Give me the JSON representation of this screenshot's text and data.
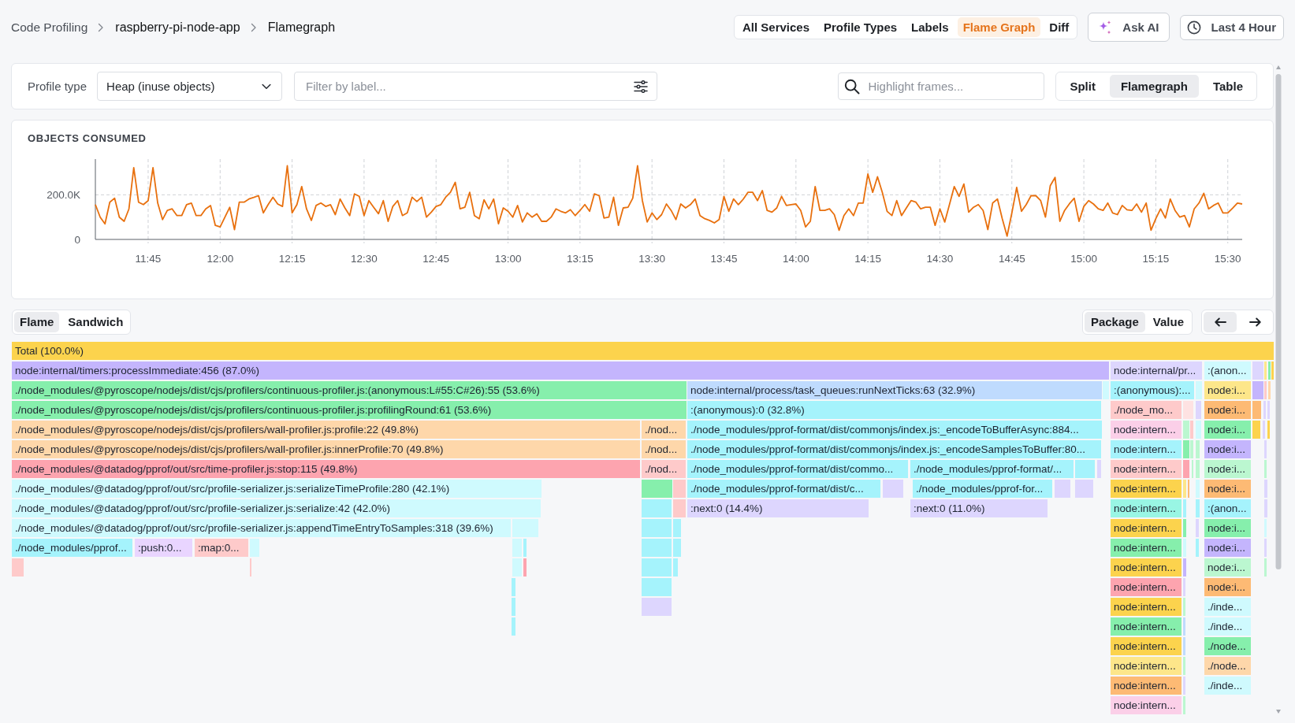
{
  "breadcrumbs": [
    "Code Profiling",
    "raspberry-pi-node-app",
    "Flamegraph"
  ],
  "nav_tabs": [
    {
      "label": "All Services",
      "selected": false
    },
    {
      "label": "Profile Types",
      "selected": false
    },
    {
      "label": "Labels",
      "selected": false
    },
    {
      "label": "Flame Graph",
      "selected": true
    },
    {
      "label": "Diff",
      "selected": false
    }
  ],
  "ask_ai_button": {
    "label": "Ask AI"
  },
  "time_range_button": {
    "label": "Last 4 Hour"
  },
  "filters": {
    "profile_type": {
      "label": "Profile type",
      "value": "Heap (inuse objects)"
    },
    "label_filter": {
      "placeholder": "Filter by label..."
    },
    "highlight": {
      "placeholder": "Highlight frames..."
    },
    "view_modes": [
      {
        "label": "Split",
        "selected": false
      },
      {
        "label": "Flamegraph",
        "selected": true
      },
      {
        "label": "Table",
        "selected": false
      }
    ]
  },
  "chart": {
    "chart_data": {
      "type": "line",
      "title": "OBJECTS CONSUMED",
      "grid": true,
      "x": [
        694,
        695,
        696,
        697,
        698,
        699,
        700,
        701,
        702,
        703,
        704,
        705,
        706,
        707,
        708,
        709,
        710,
        711,
        712,
        713,
        714,
        715,
        716,
        717,
        718,
        719,
        720,
        721,
        722,
        723,
        724,
        725,
        726,
        727,
        728,
        729,
        730,
        731,
        732,
        733,
        734,
        735,
        736,
        737,
        738,
        739,
        740,
        741,
        742,
        743,
        744,
        745,
        746,
        747,
        748,
        749,
        750,
        751,
        752,
        753,
        754,
        755,
        756,
        757,
        758,
        759,
        760,
        761,
        762,
        763,
        764,
        765,
        766,
        767,
        768,
        769,
        770,
        771,
        772,
        773,
        774,
        775,
        776,
        777,
        778,
        779,
        780,
        781,
        782,
        783,
        784,
        785,
        786,
        787,
        788,
        789,
        790,
        791,
        792,
        793,
        794,
        795,
        796,
        797,
        798,
        799,
        800,
        801,
        802,
        803,
        804,
        805,
        806,
        807,
        808,
        809,
        810,
        811,
        812,
        813,
        814,
        815,
        816,
        817,
        818,
        819,
        820,
        821,
        822,
        823,
        824,
        825,
        826,
        827,
        828,
        829,
        830,
        831,
        832,
        833,
        834,
        835,
        836,
        837,
        838,
        839,
        840,
        841,
        842,
        843,
        844,
        845,
        846,
        847,
        848,
        849,
        850,
        851,
        852,
        853,
        854,
        855,
        856,
        857,
        858,
        859,
        860,
        861,
        862,
        863,
        864,
        865,
        866,
        867,
        868,
        869,
        870,
        871,
        872,
        873,
        874,
        875,
        876,
        877,
        878,
        879,
        880,
        881,
        882,
        883,
        884,
        885,
        886,
        887,
        888,
        889,
        890,
        891,
        892,
        893,
        894,
        895,
        896,
        897,
        898,
        899,
        900,
        901,
        902,
        903,
        904,
        905,
        906,
        907,
        908,
        909,
        910,
        911,
        912,
        913,
        914,
        915,
        916,
        917,
        918,
        919,
        920,
        921,
        922,
        923,
        924,
        925,
        926,
        927,
        928,
        929,
        930,
        931,
        932,
        933
      ],
      "series": [
        {
          "color": "#e8700e",
          "values": [
            156000,
            100000,
            70000,
            167000,
            185000,
            100000,
            81000,
            137000,
            322000,
            167000,
            156000,
            174000,
            322000,
            163000,
            89000,
            130000,
            137000,
            107000,
            107000,
            156000,
            163000,
            107000,
            107000,
            137000,
            152000,
            63000,
            56000,
            100000,
            144000,
            44000,
            167000,
            167000,
            181000,
            188000,
            196000,
            119000,
            156000,
            189000,
            159000,
            148000,
            330000,
            119000,
            156000,
            237000,
            137000,
            85000,
            152000,
            163000,
            148000,
            156000,
            111000,
            181000,
            141000,
            107000,
            204000,
            193000,
            107000,
            174000,
            144000,
            115000,
            174000,
            81000,
            148000,
            174000,
            107000,
            119000,
            189000,
            170000,
            189000,
            100000,
            122000,
            148000,
            156000,
            189000,
            211000,
            256000,
            137000,
            144000,
            211000,
            107000,
            93000,
            178000,
            137000,
            181000,
            70000,
            141000,
            126000,
            100000,
            152000,
            78000,
            119000,
            100000,
            115000,
            81000,
            81000,
            100000,
            137000,
            126000,
            119000,
            133000,
            107000,
            130000,
            156000,
            126000,
            204000,
            196000,
            96000,
            100000,
            189000,
            63000,
            141000,
            144000,
            185000,
            330000,
            174000,
            78000,
            119000,
            89000,
            111000,
            159000,
            130000,
            89000,
            159000,
            141000,
            156000,
            181000,
            107000,
            93000,
            85000,
            74000,
            89000,
            193000,
            126000,
            181000,
            156000,
            180000,
            211000,
            211000,
            174000,
            219000,
            130000,
            122000,
            141000,
            193000,
            152000,
            156000,
            159000,
            130000,
            56000,
            81000,
            237000,
            130000,
            130000,
            137000,
            111000,
            41000,
            107000,
            137000,
            107000,
            163000,
            163000,
            293000,
            211000,
            281000,
            211000,
            126000,
            107000,
            174000,
            107000,
            140000,
            174000,
            167000,
            137000,
            144000,
            144000,
            63000,
            137000,
            78000,
            156000,
            237000,
            193000,
            248000,
            122000,
            144000,
            156000,
            130000,
            44000,
            163000,
            181000,
            93000,
            15000,
            119000,
            233000,
            126000,
            156000,
            196000,
            196000,
            174000,
            100000,
            241000,
            278000,
            81000,
            130000,
            160000,
            185000,
            81000,
            148000,
            174000,
            159000,
            137000,
            130000,
            163000,
            119000,
            111000,
            152000,
            133000,
            130000,
            159000,
            122000,
            163000,
            41000,
            93000,
            137000,
            96000,
            181000,
            130000,
            100000,
            107000,
            56000,
            137000,
            163000,
            207000,
            137000,
            152000,
            163000,
            119000,
            119000,
            140000,
            163000,
            159000
          ]
        }
      ],
      "xlim": [
        694,
        933
      ],
      "ylim": [
        0,
        360000
      ],
      "xticks": [
        {
          "value": 705,
          "label": "11:45"
        },
        {
          "value": 720,
          "label": "12:00"
        },
        {
          "value": 735,
          "label": "12:15"
        },
        {
          "value": 750,
          "label": "12:30"
        },
        {
          "value": 765,
          "label": "12:45"
        },
        {
          "value": 780,
          "label": "13:00"
        },
        {
          "value": 795,
          "label": "13:15"
        },
        {
          "value": 810,
          "label": "13:30"
        },
        {
          "value": 825,
          "label": "13:45"
        },
        {
          "value": 840,
          "label": "14:00"
        },
        {
          "value": 855,
          "label": "14:15"
        },
        {
          "value": 870,
          "label": "14:30"
        },
        {
          "value": 885,
          "label": "14:45"
        },
        {
          "value": 900,
          "label": "15:00"
        },
        {
          "value": 915,
          "label": "15:15"
        },
        {
          "value": 930,
          "label": "15:30"
        }
      ],
      "yticks": [
        0,
        {
          "value": 200000,
          "label": "200.0K"
        }
      ]
    }
  },
  "flamegraph": {
    "modes": [
      {
        "label": "Flame",
        "selected": true
      },
      {
        "label": "Sandwich",
        "selected": false
      }
    ],
    "color_schemes": [
      {
        "label": "Package",
        "selected": true
      },
      {
        "label": "Value",
        "selected": false
      }
    ],
    "text_align": [
      {
        "kind": "left",
        "selected": true
      },
      {
        "kind": "right",
        "selected": false
      }
    ],
    "rows": [
      {
        "frames": [
          {
            "label": "Total (100.0%)",
            "color": "#fcd34d"
          }
        ]
      },
      {
        "frames": [
          {
            "label": "node:internal/timers:processImmediate:456 (87.0%)",
            "color": "#c4b5fd"
          },
          {
            "label": "node:internal/pr...",
            "color": "#ddd6fe"
          },
          {
            "label": ":(anon...",
            "color": "#cffafe"
          },
          {
            "color": "#ddd6fe"
          },
          {
            "color": "#fde68a"
          },
          {
            "color": "#86efac"
          },
          {
            "color": "#fcd34d"
          }
        ]
      },
      {
        "frames": [
          {
            "label": "./node_modules/@pyroscope/nodejs/dist/cjs/profilers/continuous-profiler.js:(anonymous:L#55:C#26):55 (53.6%)",
            "color": "#86efac"
          },
          {
            "label": "node:internal/process/task_queues:runNextTicks:63 (32.9%)",
            "color": "#bfdbfe"
          },
          {
            "color": "#cffafe"
          },
          {
            "label": ":(anonymous):...",
            "color": "#a5f3fc"
          },
          {
            "color": "#cffafe"
          },
          {
            "label": "node:i...",
            "color": "#fde68a"
          },
          {
            "color": "#c4b5fd"
          },
          {
            "color": "#fecaca"
          },
          {
            "color": "#fed7aa"
          }
        ]
      },
      {
        "frames": [
          {
            "label": "./node_modules/@pyroscope/nodejs/dist/cjs/profilers/continuous-profiler.js:profilingRound:61 (53.6%)",
            "color": "#86efac"
          },
          {
            "label": ":(anonymous):0 (32.8%)",
            "color": "#a5f3fc"
          },
          {
            "label": "./node_mo...",
            "color": "#fecaca"
          },
          {
            "color": "#fee2e2"
          },
          {
            "color": "#ddd6fe"
          },
          {
            "label": "node:i...",
            "color": "#fdba74"
          },
          {
            "color": "#fdba74"
          },
          {
            "color": "#ddd6fe"
          },
          {
            "color": "#ddd6fe"
          }
        ]
      },
      {
        "frames": [
          {
            "label": "./node_modules/@pyroscope/nodejs/dist/cjs/profilers/wall-profiler.js:profile:22 (49.8%)",
            "color": "#fed7aa"
          },
          {
            "label": "./nod...",
            "color": "#fed7aa"
          },
          {
            "label": "./node_modules/pprof-format/dist/commonjs/index.js:_encodeToBufferAsync:884...",
            "color": "#a5f3fc"
          },
          {
            "label": "node:intern...",
            "color": "#fbcfe8"
          },
          {
            "color": "#bbf7d0"
          },
          {
            "color": "#fecaca"
          },
          {
            "color": "#cffafe"
          },
          {
            "label": "node:i...",
            "color": "#86efac"
          },
          {
            "color": "#fcd34d"
          },
          {
            "color": "#ddd6fe"
          },
          {
            "color": "#fcd34d"
          }
        ]
      },
      {
        "frames": [
          {
            "label": "./node_modules/@pyroscope/nodejs/dist/cjs/profilers/wall-profiler.js:innerProfile:70 (49.8%)",
            "color": "#fed7aa"
          },
          {
            "label": "./nod...",
            "color": "#fed7aa"
          },
          {
            "label": "./node_modules/pprof-format/dist/commonjs/index.js:_encodeSamplesToBuffer:80...",
            "color": "#a5f3fc"
          },
          {
            "label": "node:intern...",
            "color": "#a5f3fc"
          },
          {
            "color": "#86efac"
          },
          {
            "color": "#bbf7d0"
          },
          {
            "color": "#bbf7d0"
          },
          {
            "label": "node:i...",
            "color": "#c4b5fd"
          },
          {
            "color": "#ddd6fe"
          }
        ]
      },
      {
        "frames": [
          {
            "label": "./node_modules/@datadog/pprof/out/src/time-profiler.js:stop:115 (49.8%)",
            "color": "#fda4af"
          },
          {
            "label": "./nod...",
            "color": "#fecaca"
          },
          {
            "label": "./node_modules/pprof-format/dist/commo...",
            "color": "#a5f3fc"
          },
          {
            "label": "./node_modules/pprof-format/...",
            "color": "#a5f3fc"
          },
          {
            "color": "#a5f3fc"
          },
          {
            "color": "#ddd6fe"
          },
          {
            "label": "node:intern...",
            "color": "#fecaca"
          },
          {
            "color": "#fda4af"
          },
          {
            "color": "#bbf7d0"
          },
          {
            "color": "#bbf7d0"
          },
          {
            "label": "node:i...",
            "color": "#bbf7d0"
          },
          {
            "color": "#bbf7d0"
          }
        ]
      },
      {
        "frames": [
          {
            "label": "./node_modules/@datadog/pprof/out/src/profile-serializer.js:serializeTimeProfile:280 (42.1%)",
            "color": "#cffafe"
          },
          {
            "color": "#86efac"
          },
          {
            "color": "#fecaca"
          },
          {
            "label": "./node_modules/pprof-format/dist/c...",
            "color": "#a5f3fc"
          },
          {
            "color": "#ddd6fe"
          },
          {
            "label": "./node_modules/pprof-for...",
            "color": "#a5f3fc"
          },
          {
            "color": "#ddd6fe"
          },
          {
            "color": "#ddd6fe"
          },
          {
            "label": "node:intern...",
            "color": "#fcd34d"
          },
          {
            "color": "#fde68a"
          },
          {
            "color": "#fdba74"
          },
          {
            "color": "#cffafe"
          },
          {
            "label": "node:i...",
            "color": "#fdba74"
          },
          {
            "color": "#ddd6fe"
          }
        ]
      },
      {
        "frames": [
          {
            "label": "./node_modules/@datadog/pprof/out/src/profile-serializer.js:serialize:42 (42.0%)",
            "color": "#cffafe"
          },
          {
            "color": "#a5f3fc"
          },
          {
            "color": "#fecaca"
          },
          {
            "label": ":next:0 (14.4%)",
            "color": "#ddd6fe"
          },
          {
            "label": ":next:0 (11.0%)",
            "color": "#ddd6fe"
          },
          {
            "label": "node:intern...",
            "color": "#99f6e4"
          },
          {
            "color": "#a5f3fc"
          },
          {
            "color": "#a5f3fc"
          },
          {
            "label": ":(anon...",
            "color": "#a5f3fc"
          },
          {
            "color": "#ddd6fe"
          }
        ]
      },
      {
        "frames": [
          {
            "label": "./node_modules/@datadog/pprof/out/src/profile-serializer.js:appendTimeEntryToSamples:318 (39.6%)",
            "color": "#cffafe"
          },
          {
            "color": "#cffafe"
          },
          {
            "color": "#a5f3fc"
          },
          {
            "color": "#a5f3fc"
          },
          {
            "label": "node:intern...",
            "color": "#fcd34d"
          },
          {
            "color": "#86efac"
          },
          {
            "color": "#ddd6fe"
          },
          {
            "label": "node:i...",
            "color": "#86efac"
          },
          {
            "color": "#cffafe"
          }
        ]
      },
      {
        "frames": [
          {
            "label": "./node_modules/pprof...",
            "color": "#a5f3fc"
          },
          {
            "label": ":push:0...",
            "color": "#e9d5ff"
          },
          {
            "label": ":map:0...",
            "color": "#fecaca"
          },
          {
            "color": "#cffafe"
          },
          {
            "color": "#cffafe"
          },
          {
            "color": "#a5f3fc"
          },
          {
            "color": "#a5f3fc"
          },
          {
            "color": "#a5f3fc"
          },
          {
            "label": "node:intern...",
            "color": "#86efac"
          },
          {
            "color": "#cffafe"
          },
          {
            "color": "#a5f3fc"
          },
          {
            "label": "node:i...",
            "color": "#c4b5fd"
          },
          {
            "color": "#ddd6fe"
          }
        ]
      },
      {
        "frames": [
          {
            "color": "#fecaca"
          },
          {
            "color": "#fecaca"
          },
          {
            "color": "#cffafe"
          },
          {
            "color": "#fda4af"
          },
          {
            "color": "#a5f3fc"
          },
          {
            "color": "#a5f3fc"
          },
          {
            "label": "node:intern...",
            "color": "#fcd34d"
          },
          {
            "color": "#c4b5fd"
          },
          {
            "label": "node:i...",
            "color": "#bbf7d0"
          },
          {
            "color": "#bbf7d0"
          }
        ]
      },
      {
        "frames": [
          {
            "color": "#a5f3fc"
          },
          {
            "color": "#a5f3fc"
          },
          {
            "label": "node:intern...",
            "color": "#fda4af"
          },
          {
            "color": "#ddd6fe"
          },
          {
            "label": "node:i...",
            "color": "#fdba74"
          }
        ]
      },
      {
        "frames": [
          {
            "color": "#a5f3fc"
          },
          {
            "color": "#ddd6fe"
          },
          {
            "label": "node:intern...",
            "color": "#fcd34d"
          },
          {
            "color": "#bbf7d0"
          },
          {
            "label": "./inde...",
            "color": "#cffafe"
          }
        ]
      },
      {
        "frames": [
          {
            "color": "#a5f3fc"
          },
          {
            "label": "node:intern...",
            "color": "#86efac"
          },
          {
            "color": "#bfdbfe"
          },
          {
            "label": "./inde...",
            "color": "#cffafe"
          }
        ]
      },
      {
        "frames": [
          {
            "label": "node:intern...",
            "color": "#fcd34d"
          },
          {
            "color": "#bfdbfe"
          },
          {
            "label": "./node...",
            "color": "#86efac"
          }
        ]
      },
      {
        "frames": [
          {
            "label": "node:intern...",
            "color": "#fde68a"
          },
          {
            "color": "#bbf7d0"
          },
          {
            "label": "./node...",
            "color": "#fed7aa"
          }
        ]
      },
      {
        "frames": [
          {
            "label": "node:intern...",
            "color": "#fdba74"
          },
          {
            "color": "#ddd6fe"
          },
          {
            "label": "./inde...",
            "color": "#cffafe"
          }
        ]
      },
      {
        "frames": [
          {
            "label": "node:intern...",
            "color": "#fbcfe8"
          },
          {
            "color": "#bbf7d0"
          }
        ]
      }
    ]
  }
}
